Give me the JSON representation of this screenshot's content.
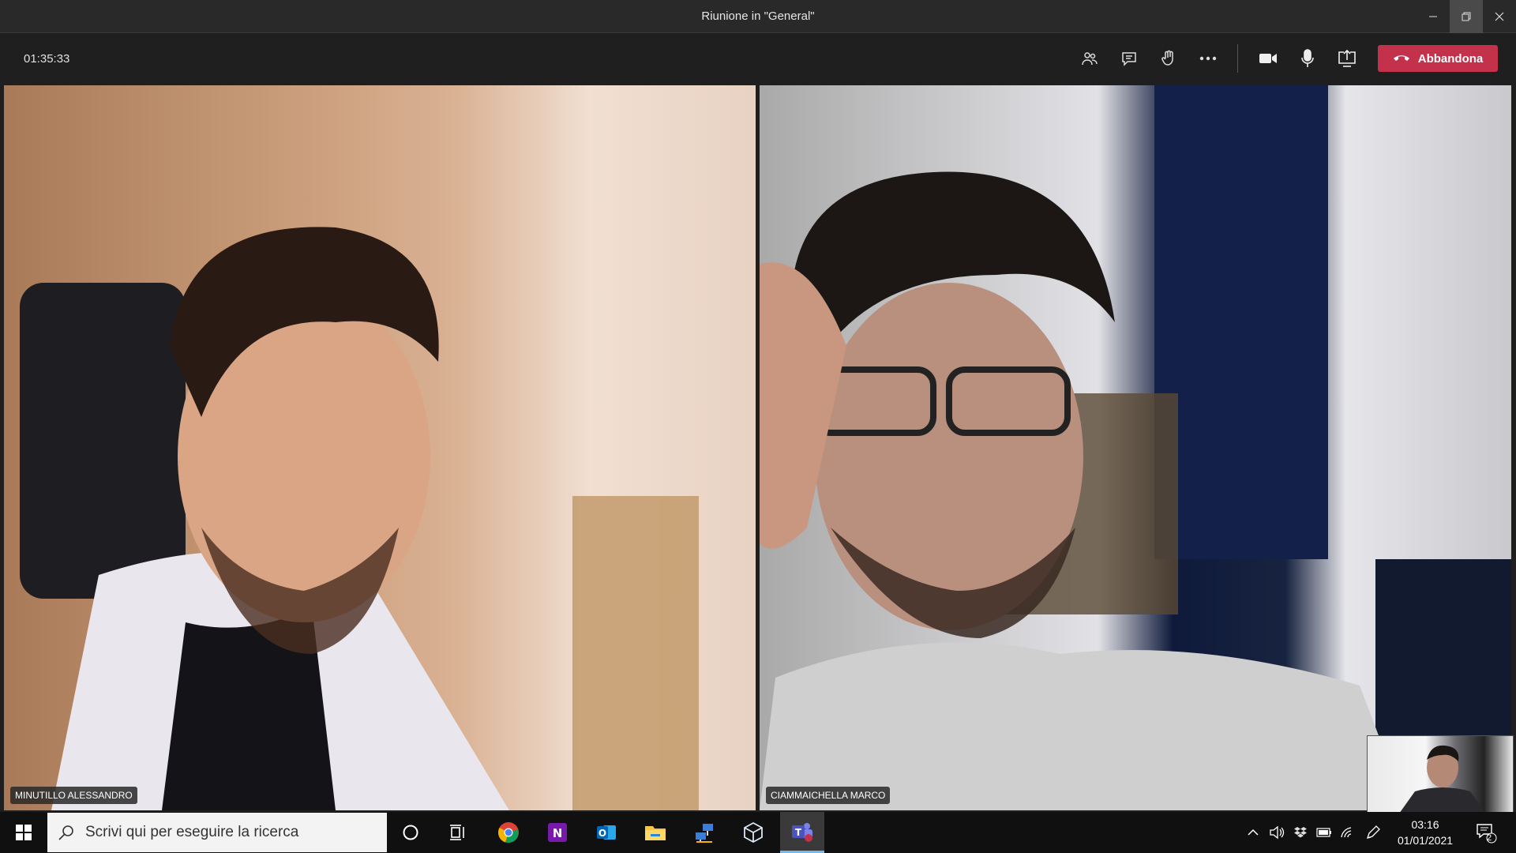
{
  "window": {
    "title": "Riunione in \"General\""
  },
  "toolbar": {
    "timer": "01:35:33",
    "leave_label": "Abbandona",
    "icons": [
      "participants-icon",
      "chat-icon",
      "raise-hand-icon",
      "more-icon",
      "camera-icon",
      "microphone-icon",
      "share-screen-icon"
    ]
  },
  "participants": [
    {
      "name": "MINUTILLO ALESSANDRO"
    },
    {
      "name": "CIAMMAICHELLA MARCO"
    }
  ],
  "taskbar": {
    "search_placeholder": "Scrivi qui per eseguire la ricerca",
    "clock_time": "03:16",
    "clock_date": "01/01/2021",
    "notification_count": "2",
    "apps": [
      "cortana",
      "task-view",
      "chrome",
      "onenote",
      "outlook",
      "file-explorer",
      "network-app",
      "3d-viewer",
      "teams"
    ]
  },
  "colors": {
    "leave": "#c4314b",
    "toolbar_bg": "#1f1f1f",
    "titlebar_bg": "#292929",
    "taskbar_bg": "#101010"
  }
}
